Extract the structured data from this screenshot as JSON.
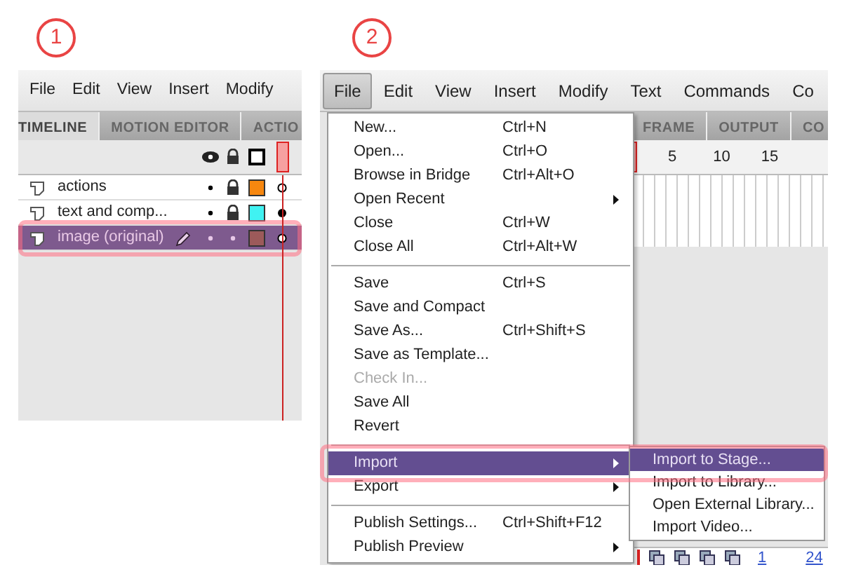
{
  "steps": [
    {
      "number": "1",
      "menu_bar": [
        {
          "label": "File",
          "selected": false
        },
        {
          "label": "Edit",
          "selected": false
        },
        {
          "label": "View",
          "selected": false
        },
        {
          "label": "Insert",
          "selected": false
        },
        {
          "label": "Modify",
          "selected": false
        }
      ],
      "tabs": [
        {
          "label": "TIMELINE",
          "selected": true
        },
        {
          "label": "MOTION EDITOR",
          "selected": false
        },
        {
          "label": "ACTIO",
          "selected": false
        }
      ],
      "layers": [
        {
          "name": "actions",
          "selected": false,
          "highlighted": false,
          "locked": true,
          "color": "#f7870f",
          "keyframe_filled": false
        },
        {
          "name": "text and comp...",
          "selected": false,
          "highlighted": false,
          "locked": true,
          "color": "#40f2f2",
          "keyframe_filled": true
        },
        {
          "name": "image (original)",
          "selected": true,
          "highlighted": true,
          "locked": false,
          "color": "#9c5a5a",
          "keyframe_filled": false
        }
      ]
    },
    {
      "number": "2",
      "menu_bar": [
        {
          "label": "File",
          "selected": true
        },
        {
          "label": "Edit",
          "selected": false
        },
        {
          "label": "View",
          "selected": false
        },
        {
          "label": "Insert",
          "selected": false
        },
        {
          "label": "Modify",
          "selected": false
        },
        {
          "label": "Text",
          "selected": false
        },
        {
          "label": "Commands",
          "selected": false
        },
        {
          "label": "Co",
          "selected": false
        }
      ],
      "tabs": [
        {
          "label": "FRAME"
        },
        {
          "label": "OUTPUT"
        },
        {
          "label": "CO"
        }
      ],
      "ruler": [
        "5",
        "10",
        "15"
      ],
      "file_menu": [
        {
          "kind": "item",
          "label": "New...",
          "shortcut": "Ctrl+N",
          "submenu": false,
          "disabled": false,
          "selected": false,
          "highlighted": false
        },
        {
          "kind": "item",
          "label": "Open...",
          "shortcut": "Ctrl+O",
          "submenu": false,
          "disabled": false,
          "selected": false,
          "highlighted": false
        },
        {
          "kind": "item",
          "label": "Browse in Bridge",
          "shortcut": "Ctrl+Alt+O",
          "submenu": false,
          "disabled": false,
          "selected": false,
          "highlighted": false
        },
        {
          "kind": "item",
          "label": "Open Recent",
          "submenu": true,
          "disabled": false,
          "selected": false,
          "highlighted": false
        },
        {
          "kind": "item",
          "label": "Close",
          "shortcut": "Ctrl+W",
          "submenu": false,
          "disabled": false,
          "selected": false,
          "highlighted": false
        },
        {
          "kind": "item",
          "label": "Close All",
          "shortcut": "Ctrl+Alt+W",
          "submenu": false,
          "disabled": false,
          "selected": false,
          "highlighted": false
        },
        {
          "kind": "separator"
        },
        {
          "kind": "item",
          "label": "Save",
          "shortcut": "Ctrl+S",
          "submenu": false,
          "disabled": false,
          "selected": false,
          "highlighted": false
        },
        {
          "kind": "item",
          "label": "Save and Compact",
          "submenu": false,
          "disabled": false,
          "selected": false,
          "highlighted": false
        },
        {
          "kind": "item",
          "label": "Save As...",
          "shortcut": "Ctrl+Shift+S",
          "submenu": false,
          "disabled": false,
          "selected": false,
          "highlighted": false
        },
        {
          "kind": "item",
          "label": "Save as Template...",
          "submenu": false,
          "disabled": false,
          "selected": false,
          "highlighted": false
        },
        {
          "kind": "item",
          "label": "Check In...",
          "submenu": false,
          "disabled": true,
          "selected": false,
          "highlighted": false
        },
        {
          "kind": "item",
          "label": "Save All",
          "submenu": false,
          "disabled": false,
          "selected": false,
          "highlighted": false
        },
        {
          "kind": "item",
          "label": "Revert",
          "submenu": false,
          "disabled": false,
          "selected": false,
          "highlighted": false
        },
        {
          "kind": "separator"
        },
        {
          "kind": "item",
          "label": "Import",
          "submenu": true,
          "disabled": false,
          "selected": true,
          "highlighted": true
        },
        {
          "kind": "item",
          "label": "Export",
          "submenu": true,
          "disabled": false,
          "selected": false,
          "highlighted": false
        },
        {
          "kind": "separator"
        },
        {
          "kind": "item",
          "label": "Publish Settings...",
          "shortcut": "Ctrl+Shift+F12",
          "submenu": false,
          "disabled": false,
          "selected": false,
          "highlighted": false
        },
        {
          "kind": "item",
          "label": "Publish Preview",
          "submenu": true,
          "disabled": false,
          "selected": false,
          "highlighted": false
        }
      ],
      "import_submenu": [
        {
          "label": "Import to Stage...",
          "selected": true
        },
        {
          "label": "Import to Library...",
          "selected": false
        },
        {
          "label": "Open External Library...",
          "selected": false
        },
        {
          "label": "Import Video...",
          "selected": false
        }
      ],
      "timeline_status": [
        "1",
        "24"
      ]
    }
  ]
}
